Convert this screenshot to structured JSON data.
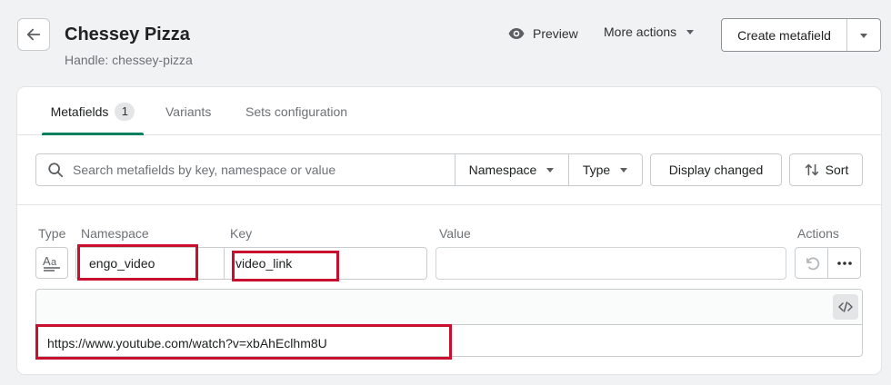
{
  "header": {
    "title": "Chessey Pizza",
    "subtitle": "Handle: chessey-pizza",
    "preview_label": "Preview",
    "more_actions_label": "More actions",
    "create_label": "Create metafield"
  },
  "tabs": [
    {
      "label": "Metafields",
      "count": "1",
      "active": true
    },
    {
      "label": "Variants",
      "active": false
    },
    {
      "label": "Sets configuration",
      "active": false
    }
  ],
  "filters": {
    "search_placeholder": "Search metafields by key, namespace or value",
    "namespace_label": "Namespace",
    "type_label": "Type",
    "display_changed_label": "Display changed",
    "sort_label": "Sort"
  },
  "table": {
    "headers": {
      "type": "Type",
      "namespace": "Namespace",
      "key": "Key",
      "value": "Value",
      "actions": "Actions"
    },
    "row": {
      "namespace": "engo_video",
      "key": "video_link",
      "value": "",
      "content": "https://www.youtube.com/watch?v=xbAhEclhm8U"
    }
  },
  "colors": {
    "accent": "#008060",
    "highlight": "#c8102e"
  }
}
